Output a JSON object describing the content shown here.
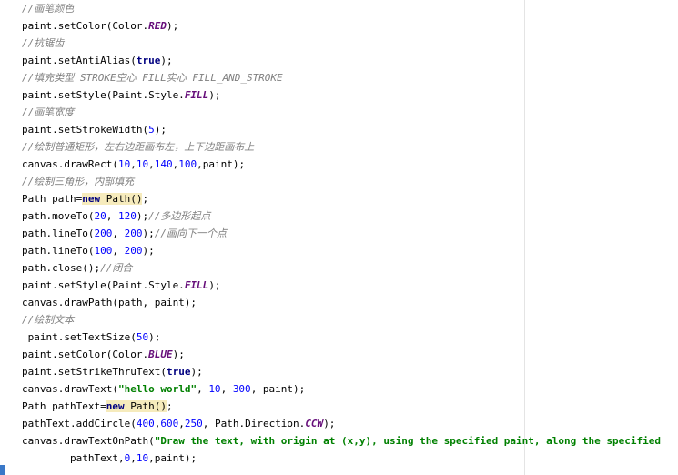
{
  "editor": {
    "lines": [
      [
        {
          "t": "//画笔颜色",
          "c": "c"
        }
      ],
      [
        {
          "t": "paint.setColor(Color."
        },
        {
          "t": "RED",
          "c": "f"
        },
        {
          "t": ");"
        }
      ],
      [
        {
          "t": "//抗锯齿",
          "c": "c"
        }
      ],
      [
        {
          "t": "paint.setAntiAlias("
        },
        {
          "t": "true",
          "c": "k"
        },
        {
          "t": ");"
        }
      ],
      [
        {
          "t": "//填充类型 STROKE空心 FILL实心 FILL_AND_STROKE",
          "c": "c"
        }
      ],
      [
        {
          "t": "paint.setStyle(Paint.Style."
        },
        {
          "t": "FILL",
          "c": "f"
        },
        {
          "t": ");"
        }
      ],
      [
        {
          "t": "//画笔宽度",
          "c": "c"
        }
      ],
      [
        {
          "t": "paint.setStrokeWidth("
        },
        {
          "t": "5",
          "c": "n"
        },
        {
          "t": ");"
        }
      ],
      [
        {
          "t": "//绘制普通矩形，左右边距画布左，上下边距画布上",
          "c": "c"
        }
      ],
      [
        {
          "t": "canvas.drawRect("
        },
        {
          "t": "10",
          "c": "n"
        },
        {
          "t": ","
        },
        {
          "t": "10",
          "c": "n"
        },
        {
          "t": ","
        },
        {
          "t": "140",
          "c": "n"
        },
        {
          "t": ","
        },
        {
          "t": "100",
          "c": "n"
        },
        {
          "t": ",paint);"
        }
      ],
      [
        {
          "t": "//绘制三角形，内部填充",
          "c": "c"
        }
      ],
      [
        {
          "t": "Path path="
        },
        {
          "t": "new",
          "c": "k hl"
        },
        {
          "t": " Path()",
          "c": "hl"
        },
        {
          "t": ";"
        }
      ],
      [
        {
          "t": "path.moveTo("
        },
        {
          "t": "20",
          "c": "n"
        },
        {
          "t": ", "
        },
        {
          "t": "120",
          "c": "n"
        },
        {
          "t": ");"
        },
        {
          "t": "//多边形起点",
          "c": "c"
        }
      ],
      [
        {
          "t": "path.lineTo("
        },
        {
          "t": "200",
          "c": "n"
        },
        {
          "t": ", "
        },
        {
          "t": "200",
          "c": "n"
        },
        {
          "t": ");"
        },
        {
          "t": "//画向下一个点",
          "c": "c"
        }
      ],
      [
        {
          "t": "path.lineTo("
        },
        {
          "t": "100",
          "c": "n"
        },
        {
          "t": ", "
        },
        {
          "t": "200",
          "c": "n"
        },
        {
          "t": ");"
        }
      ],
      [
        {
          "t": "path.close();"
        },
        {
          "t": "//闭合",
          "c": "c"
        }
      ],
      [
        {
          "t": "paint.setStyle(Paint.Style."
        },
        {
          "t": "FILL",
          "c": "f"
        },
        {
          "t": ");"
        }
      ],
      [
        {
          "t": "canvas.drawPath(path, paint);"
        }
      ],
      [
        {
          "t": "//绘制文本",
          "c": "c"
        }
      ],
      [
        {
          "t": " paint.setTextSize("
        },
        {
          "t": "50",
          "c": "n"
        },
        {
          "t": ");"
        }
      ],
      [
        {
          "t": "paint.setColor(Color."
        },
        {
          "t": "BLUE",
          "c": "f"
        },
        {
          "t": ");"
        }
      ],
      [
        {
          "t": "paint.setStrikeThruText("
        },
        {
          "t": "true",
          "c": "k"
        },
        {
          "t": ");"
        }
      ],
      [
        {
          "t": "canvas.drawText("
        },
        {
          "t": "\"hello world\"",
          "c": "s"
        },
        {
          "t": ", "
        },
        {
          "t": "10",
          "c": "n"
        },
        {
          "t": ", "
        },
        {
          "t": "300",
          "c": "n"
        },
        {
          "t": ", paint);"
        }
      ],
      [
        {
          "t": "Path pathText="
        },
        {
          "t": "new",
          "c": "k hl"
        },
        {
          "t": " Path()",
          "c": "hl"
        },
        {
          "t": ";"
        }
      ],
      [
        {
          "t": "pathText.addCircle("
        },
        {
          "t": "400",
          "c": "n"
        },
        {
          "t": ","
        },
        {
          "t": "600",
          "c": "n"
        },
        {
          "t": ","
        },
        {
          "t": "250",
          "c": "n"
        },
        {
          "t": ", Path.Direction."
        },
        {
          "t": "CCW",
          "c": "f"
        },
        {
          "t": ");"
        }
      ],
      [
        {
          "t": "canvas.drawTextOnPath("
        },
        {
          "t": "\"Draw the text, with origin at (x,y), using the specified paint, along the specified",
          "c": "s"
        }
      ],
      [
        {
          "t": "        pathText,"
        },
        {
          "t": "0",
          "c": "n"
        },
        {
          "t": ","
        },
        {
          "t": "10",
          "c": "n"
        },
        {
          "t": ",paint);"
        }
      ]
    ]
  }
}
